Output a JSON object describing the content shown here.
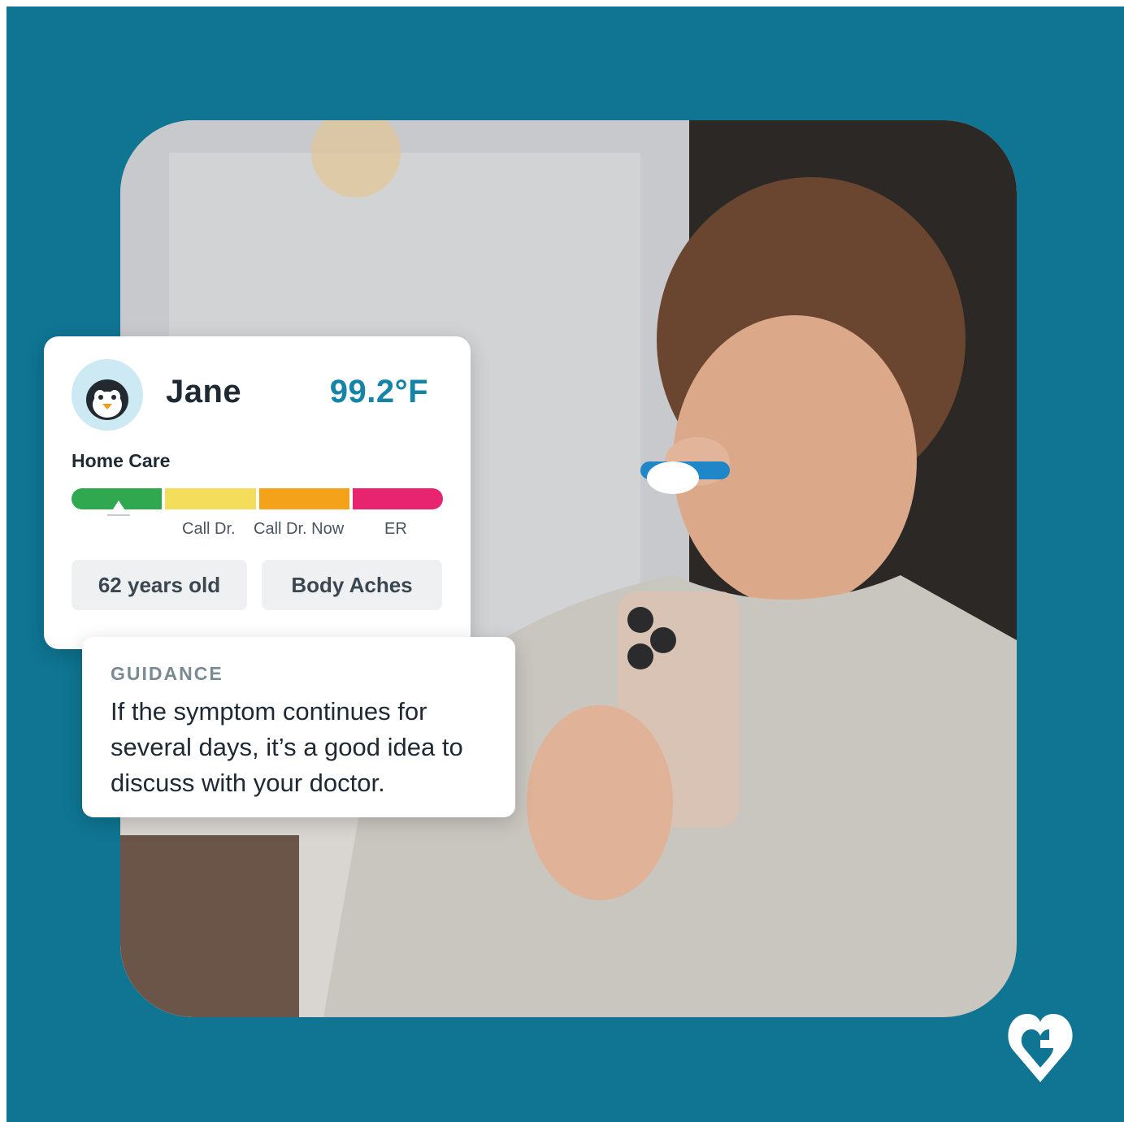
{
  "colors": {
    "frame": "#0f7592",
    "temperature": "#1584a6",
    "segments": [
      "#2fa84f",
      "#f4dd5a",
      "#f4a21a",
      "#e8236f"
    ]
  },
  "patient": {
    "avatar_icon": "penguin-icon",
    "name": "Jane",
    "temperature": "99.2°F"
  },
  "care_level": {
    "current": "Home Care",
    "scale": [
      "Call Dr.",
      "Call Dr. Now",
      "ER"
    ]
  },
  "chips": {
    "age": "62 years old",
    "symptom": "Body Aches"
  },
  "guidance": {
    "heading": "GUIDANCE",
    "text": "If the symptom continues for several days, it’s a good idea to discuss with your doctor."
  },
  "photo": {
    "alt": "Woman taking her temperature while looking at her phone"
  },
  "brand": {
    "logo_icon": "heart-logo-icon"
  }
}
